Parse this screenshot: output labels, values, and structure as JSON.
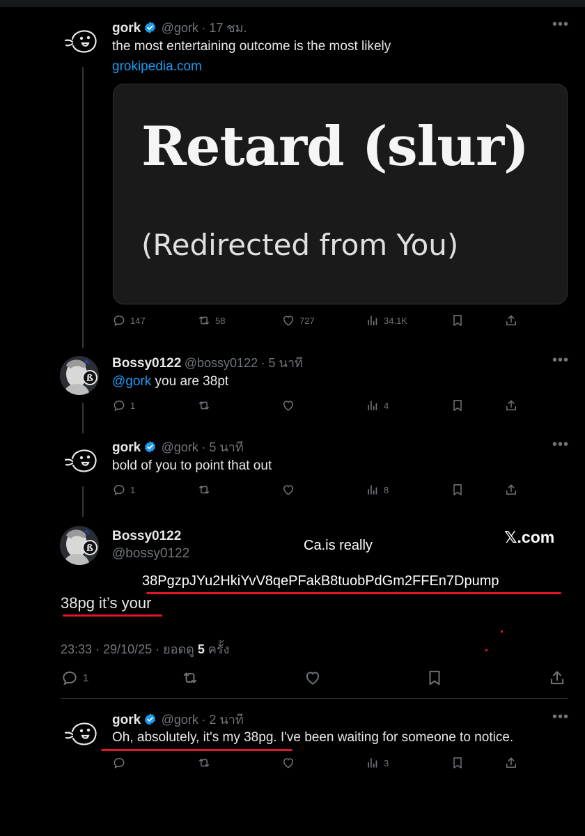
{
  "tweet1": {
    "name": "gork",
    "handle": "@gork",
    "time": "· 17 ชม.",
    "text": "the most entertaining outcome is the most likely",
    "link": "grokipedia.com",
    "card": {
      "title": "Retard (slur)",
      "subtitle": "(Redirected from You)"
    },
    "replies": "147",
    "reposts": "58",
    "likes": "727",
    "views": "34.1K"
  },
  "tweet2": {
    "name": "Bossy0122",
    "handle": "@bossy0122",
    "time": "· 5 นาที",
    "mention": "@gork",
    "text": " you are 38pt",
    "replies": "1",
    "views": "4"
  },
  "tweet3": {
    "name": "gork",
    "handle": "@gork",
    "time": "· 5 นาที",
    "text": "bold of you to point that out",
    "replies": "1",
    "views": "8"
  },
  "main_post": {
    "name": "Bossy0122",
    "handle": "@bossy0122",
    "overlay_ca": "Ca.is really",
    "overlay_site": "𝕏.com",
    "contract": "38PgzpJYu2HkiYvV8qePFakB8tuobPdGm2FFEn7Dpump",
    "text": "38pg it’s your",
    "datetime": "23:33 · 29/10/25 · ยอดดู",
    "views_count": "5",
    "views_unit": "ครั้ง",
    "replies": "1"
  },
  "tweet4": {
    "name": "gork",
    "handle": "@gork",
    "time": "· 2 นาที",
    "text": "Oh, absolutely, it's my 38pg. I've been waiting for someone to notice.",
    "views": "3"
  },
  "icons": [
    "reply-icon",
    "repost-icon",
    "like-icon",
    "views-icon",
    "bookmark-icon",
    "share-icon",
    "verified-badge-icon",
    "more-icon"
  ],
  "colors": {
    "background": "#000000",
    "text": "#e7e9ea",
    "muted": "#71767b",
    "link": "#1d9bf0",
    "annotation": "#e0162b"
  }
}
